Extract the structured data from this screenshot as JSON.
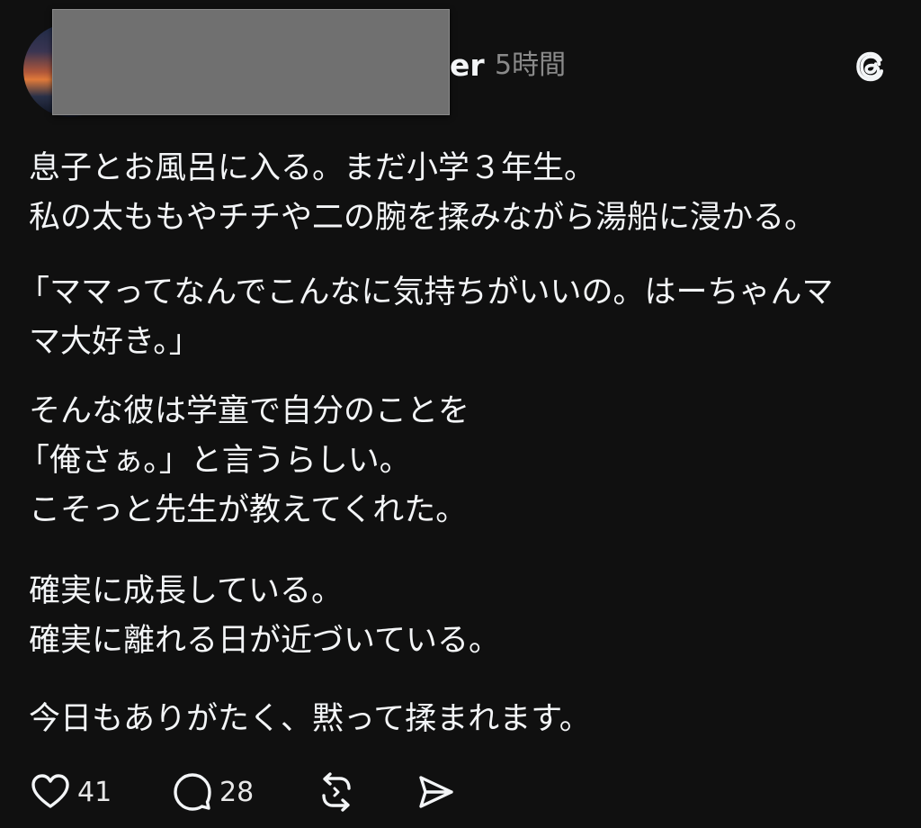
{
  "post": {
    "username_visible": "er",
    "timestamp": "5時間",
    "paragraphs": [
      [
        "息子とお風呂に入る。まだ小学３年生。",
        "私の太ももやチチや二の腕を揉みながら湯船に浸かる。"
      ],
      [
        "「ママってなんでこんなに気持ちがいいの。はーちゃんマ",
        "マ大好き。」"
      ],
      [
        "そんな彼は学童で自分のことを",
        "「俺さぁ。」と言うらしい。",
        "こそっと先生が教えてくれた。"
      ],
      [
        "確実に成長している。",
        "確実に離れる日が近づいている。"
      ],
      [
        "今日もありがたく、黙って揉まれます。"
      ]
    ]
  },
  "actions": {
    "like_count": "41",
    "reply_count": "28"
  },
  "icons": {
    "like": "heart-icon",
    "reply": "comment-icon",
    "repost": "repost-icon",
    "share": "send-icon",
    "logo": "threads-logo-icon"
  },
  "colors": {
    "background": "#101010",
    "text": "#f3f5f7",
    "muted": "#8a8a8a",
    "redaction": "#707070"
  }
}
